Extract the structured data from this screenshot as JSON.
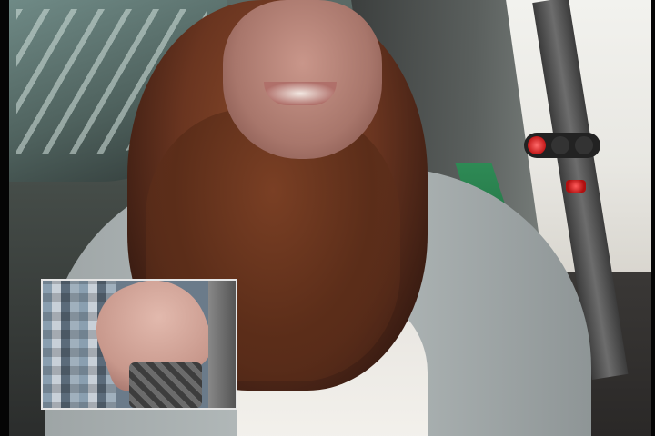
{
  "scene": {
    "signal_color": "#c21818",
    "sign_color": "#2e8a55",
    "cardigan_color": "#b8bfbf",
    "hair_color": "#6a3520"
  },
  "inset": {
    "border_color": "#e6e6e6"
  }
}
